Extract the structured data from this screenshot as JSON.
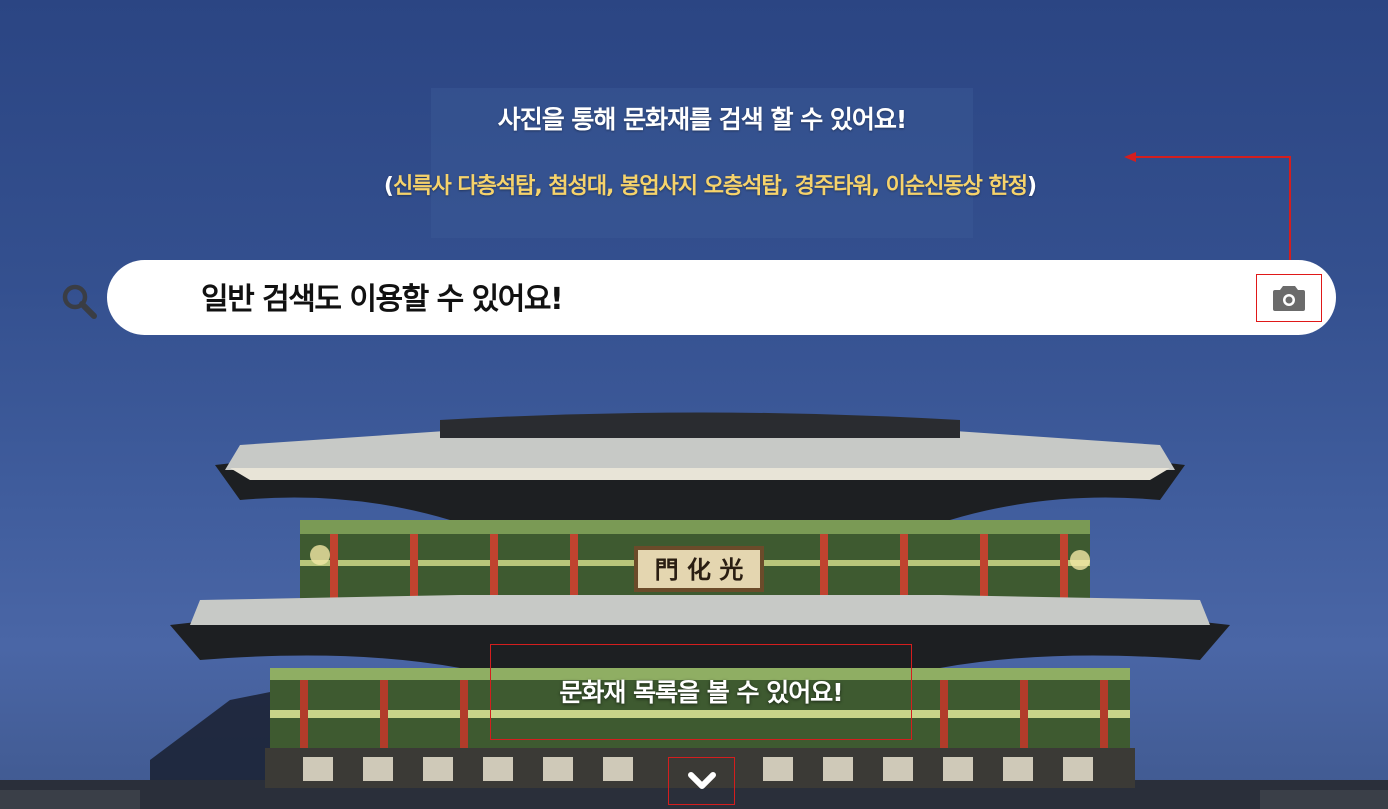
{
  "info": {
    "title": "사진을 통해 문화재를 검색 할 수 있어요!",
    "subtitle_open": "(",
    "subtitle_list": "신륵사 다층석탑, 첨성대, 봉업사지 오층석탑, 경주타워, 이순신동상 한정",
    "subtitle_close": ")"
  },
  "search": {
    "text": "일반 검색도 이용할 수 있어요!",
    "search_icon": "search-icon",
    "camera_icon": "camera-icon"
  },
  "list": {
    "label": "문화재 목록을 볼 수 있어요!",
    "chevron_icon": "chevron-down-icon"
  },
  "colors": {
    "sky_top": "#2b4583",
    "highlight_yellow": "#f6d36b",
    "annotation_red": "#d41e1e"
  }
}
